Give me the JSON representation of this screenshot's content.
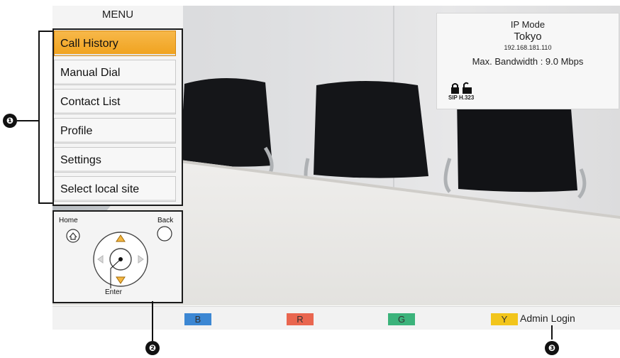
{
  "menu": {
    "title": "MENU",
    "items": [
      {
        "label": "Call History",
        "active": true
      },
      {
        "label": "Manual Dial"
      },
      {
        "label": "Contact List"
      },
      {
        "label": "Profile"
      },
      {
        "label": "Settings"
      },
      {
        "label": "Select local site"
      }
    ]
  },
  "info": {
    "mode": "IP Mode",
    "site": "Tokyo",
    "ip": "192.168.181.110",
    "bandwidth": "Max. Bandwidth : 9.0 Mbps",
    "protocols": "SIP H.323"
  },
  "remote": {
    "home_label": "Home",
    "back_label": "Back",
    "enter_label": "Enter"
  },
  "bottom": {
    "buttons": [
      {
        "label": "B",
        "color": "#3c87d3"
      },
      {
        "label": "R",
        "color": "#e9664f"
      },
      {
        "label": "G",
        "color": "#3cb37b"
      },
      {
        "label": "Y",
        "color": "#f2c51b"
      }
    ],
    "admin_label": "Admin Login"
  },
  "callouts": [
    "❶",
    "❷",
    "❸"
  ],
  "accent_color": "#f0a21d"
}
